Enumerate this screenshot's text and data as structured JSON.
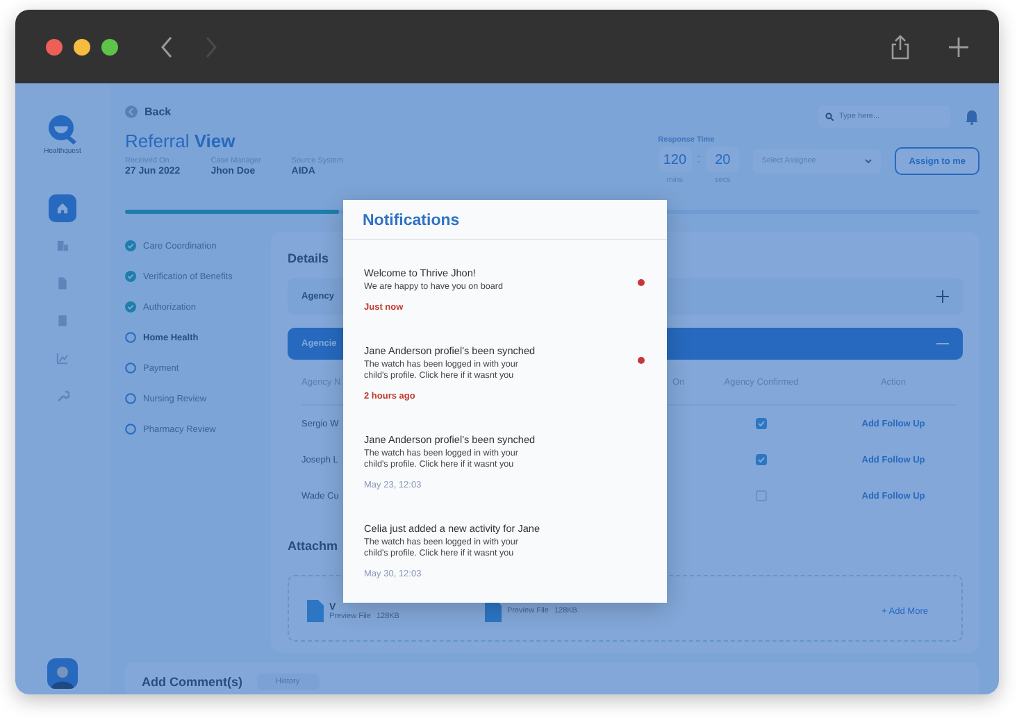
{
  "sidebar": {
    "logo": "Healthquest",
    "items": [
      {
        "kind": "home",
        "selected": true
      },
      {
        "kind": "files",
        "selected": false
      },
      {
        "kind": "file",
        "selected": false
      },
      {
        "kind": "book",
        "selected": false
      },
      {
        "kind": "chart",
        "selected": false
      },
      {
        "kind": "wrench",
        "selected": false
      }
    ]
  },
  "header": {
    "back": "Back",
    "title_light": "Referral",
    "title_bold": "View",
    "meta": [
      {
        "label": "Received On",
        "value": "27 Jun 2022"
      },
      {
        "label": "Case Manager",
        "value": "Jhon Doe"
      },
      {
        "label": "Source System",
        "value": "AIDA"
      }
    ]
  },
  "search": {
    "placeholder": "Type here..."
  },
  "response_time": {
    "label": "Response Time",
    "separator": ":",
    "parts": [
      {
        "value": "120",
        "unit": "mins"
      },
      {
        "value": "20",
        "unit": "secs"
      }
    ]
  },
  "assignee": {
    "placeholder": "Select Assignee"
  },
  "assign_button": "Assign to me",
  "progress": {
    "level": 0.25
  },
  "steps": [
    {
      "label": "Care Coordination",
      "done": true,
      "current": false
    },
    {
      "label": "Verification of Benefits",
      "done": true,
      "current": false
    },
    {
      "label": "Authorization",
      "done": true,
      "current": false
    },
    {
      "label": "Home Health",
      "done": false,
      "current": true
    },
    {
      "label": "Payment",
      "done": false,
      "current": false
    },
    {
      "label": "Nursing Review",
      "done": false,
      "current": false
    },
    {
      "label": "Pharmacy Review",
      "done": false,
      "current": false
    }
  ],
  "details": {
    "title": "Details",
    "sections": [
      {
        "label": "Agency",
        "expanded": false
      },
      {
        "label": "Agencie",
        "expanded": true
      }
    ],
    "table": {
      "columns": [
        "Agency N",
        "On",
        "Agency Confirmed",
        "Action"
      ],
      "rows": [
        {
          "name": "Sergio W",
          "confirmed": true,
          "action": "Add Follow Up"
        },
        {
          "name": "Joseph L",
          "confirmed": true,
          "action": "Add Follow Up"
        },
        {
          "name": "Wade Cu",
          "confirmed": false,
          "action": "Add Follow Up"
        }
      ]
    }
  },
  "attachments": {
    "title": "Attachm",
    "add_more": "+ Add More",
    "files": [
      {
        "name": "V",
        "preview": "Preview File",
        "size": "128KB"
      },
      {
        "preview": "Preview File",
        "size": "128KB"
      }
    ]
  },
  "comments": {
    "title": "Add Comment(s)",
    "tab": "History"
  },
  "notifications": {
    "title": "Notifications",
    "items": [
      {
        "title": "Welcome to Thrive Jhon!",
        "body": "We are happy to have you on board",
        "time": "Just now",
        "unread": true
      },
      {
        "title": "Jane Anderson profiel's been synched",
        "body": "The watch has been logged in with your child's profile. Click here if it wasnt you",
        "time": "2 hours ago",
        "unread": true
      },
      {
        "title": "Jane Anderson profiel's been synched",
        "body": "The watch has been logged in with your child's profile. Click here if it wasnt you",
        "time": "May 23, 12:03",
        "unread": false
      },
      {
        "title": "Celia just added a new activity for Jane",
        "body": "The watch has been logged in with your child's profile. Click here if it wasnt you",
        "time": "May 30, 12:03",
        "unread": false
      }
    ]
  }
}
